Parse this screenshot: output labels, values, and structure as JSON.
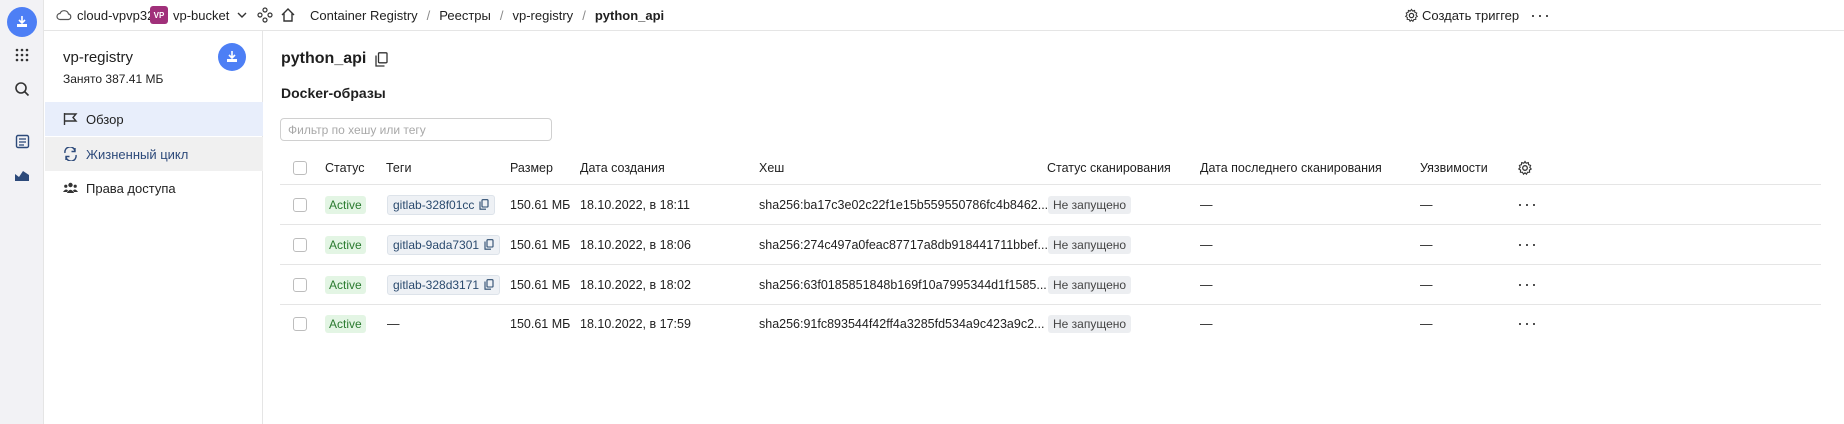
{
  "topbar": {
    "cloud_name": "cloud-vpvp32",
    "folder_badge": "VP",
    "folder_name": "vp-bucket",
    "breadcrumbs": [
      "Container Registry",
      "Реестры",
      "vp-registry",
      "python_api"
    ],
    "create_trigger_label": "Создать триггер"
  },
  "sidebar": {
    "registry_name": "vp-registry",
    "usage": "Занято 387.41 МБ",
    "items": [
      {
        "label": "Обзор",
        "icon": "flag-icon"
      },
      {
        "label": "Жизненный цикл",
        "icon": "refresh-icon"
      },
      {
        "label": "Права доступа",
        "icon": "users-icon"
      }
    ]
  },
  "main": {
    "title": "python_api",
    "section": "Docker-образы",
    "filter_placeholder": "Фильтр по хешу или тегу",
    "columns": {
      "status": "Статус",
      "tags": "Теги",
      "size": "Размер",
      "created": "Дата создания",
      "hash": "Хеш",
      "scan_status": "Статус сканирования",
      "last_scan": "Дата последнего сканирования",
      "vulns": "Уязвимости"
    },
    "rows": [
      {
        "status": "Active",
        "tag": "gitlab-328f01cc",
        "size": "150.61 МБ",
        "created": "18.10.2022, в 18:11",
        "hash": "sha256:ba17c3e02c22f1e15b559550786fc4b8462...",
        "scan_status": "Не запущено",
        "last_scan": "—",
        "vulns": "—"
      },
      {
        "status": "Active",
        "tag": "gitlab-9ada7301",
        "size": "150.61 МБ",
        "created": "18.10.2022, в 18:06",
        "hash": "sha256:274c497a0feac87717a8db918441711bbef...",
        "scan_status": "Не запущено",
        "last_scan": "—",
        "vulns": "—"
      },
      {
        "status": "Active",
        "tag": "gitlab-328d3171",
        "size": "150.61 МБ",
        "created": "18.10.2022, в 18:02",
        "hash": "sha256:63f0185851848b169f10a7995344d1f1585...",
        "scan_status": "Не запущено",
        "last_scan": "—",
        "vulns": "—"
      },
      {
        "status": "Active",
        "tag": "—",
        "size": "150.61 МБ",
        "created": "18.10.2022, в 17:59",
        "hash": "sha256:91fc893544f42ff4a3285fd534a9c423a9c2...",
        "scan_status": "Не запущено",
        "last_scan": "—",
        "vulns": "—"
      }
    ]
  },
  "colors": {
    "accent": "#4d7ff5",
    "active_badge_bg": "#e3f5e4",
    "active_badge_text": "#2a7a2f",
    "nav_active_bg": "#e8eefb"
  }
}
